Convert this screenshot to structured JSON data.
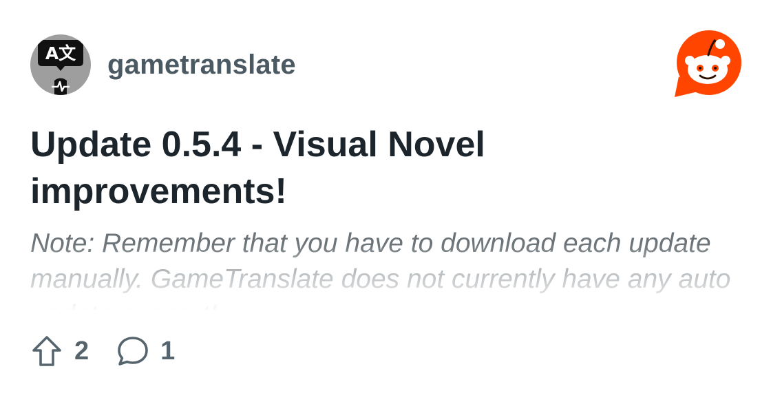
{
  "post": {
    "subreddit": "gametranslate",
    "title": "Update 0.5.4 - Visual Novel improvements!",
    "excerpt": "Note: Remember that you have to download each update manually. GameTranslate does not currently have any auto update support!",
    "upvotes": "2",
    "comments": "1"
  },
  "avatar": {
    "icon": "translate-icon",
    "glyphs": "A文"
  },
  "icons": {
    "upvote": "upvote-arrow-icon",
    "comment": "comment-bubble-icon",
    "brand": "reddit-logo-icon"
  },
  "colors": {
    "brand": "#ff4500",
    "title": "#1c252b",
    "meta": "#4b5962",
    "excerpt": "#6b7378",
    "avatar_bg": "#9e9e9e"
  }
}
